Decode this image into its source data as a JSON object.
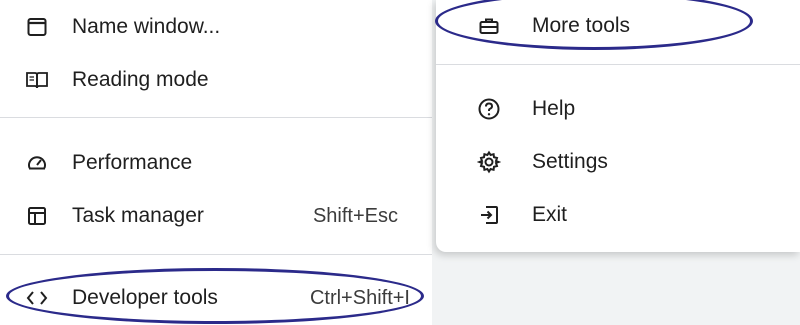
{
  "left_menu": {
    "items": [
      {
        "label": "Name window...",
        "icon": "window-icon"
      },
      {
        "label": "Reading mode",
        "icon": "book-icon"
      },
      {
        "label": "Performance",
        "icon": "gauge-icon"
      },
      {
        "label": "Task manager",
        "icon": "task-manager-icon",
        "shortcut": "Shift+Esc"
      },
      {
        "label": "Developer tools",
        "icon": "code-icon",
        "shortcut": "Ctrl+Shift+I"
      }
    ]
  },
  "right_menu": {
    "items": [
      {
        "label": "More tools",
        "icon": "toolbox-icon"
      },
      {
        "label": "Help",
        "icon": "help-icon"
      },
      {
        "label": "Settings",
        "icon": "gear-icon"
      },
      {
        "label": "Exit",
        "icon": "exit-icon"
      }
    ]
  },
  "annotation_color": "#2b2a8a"
}
